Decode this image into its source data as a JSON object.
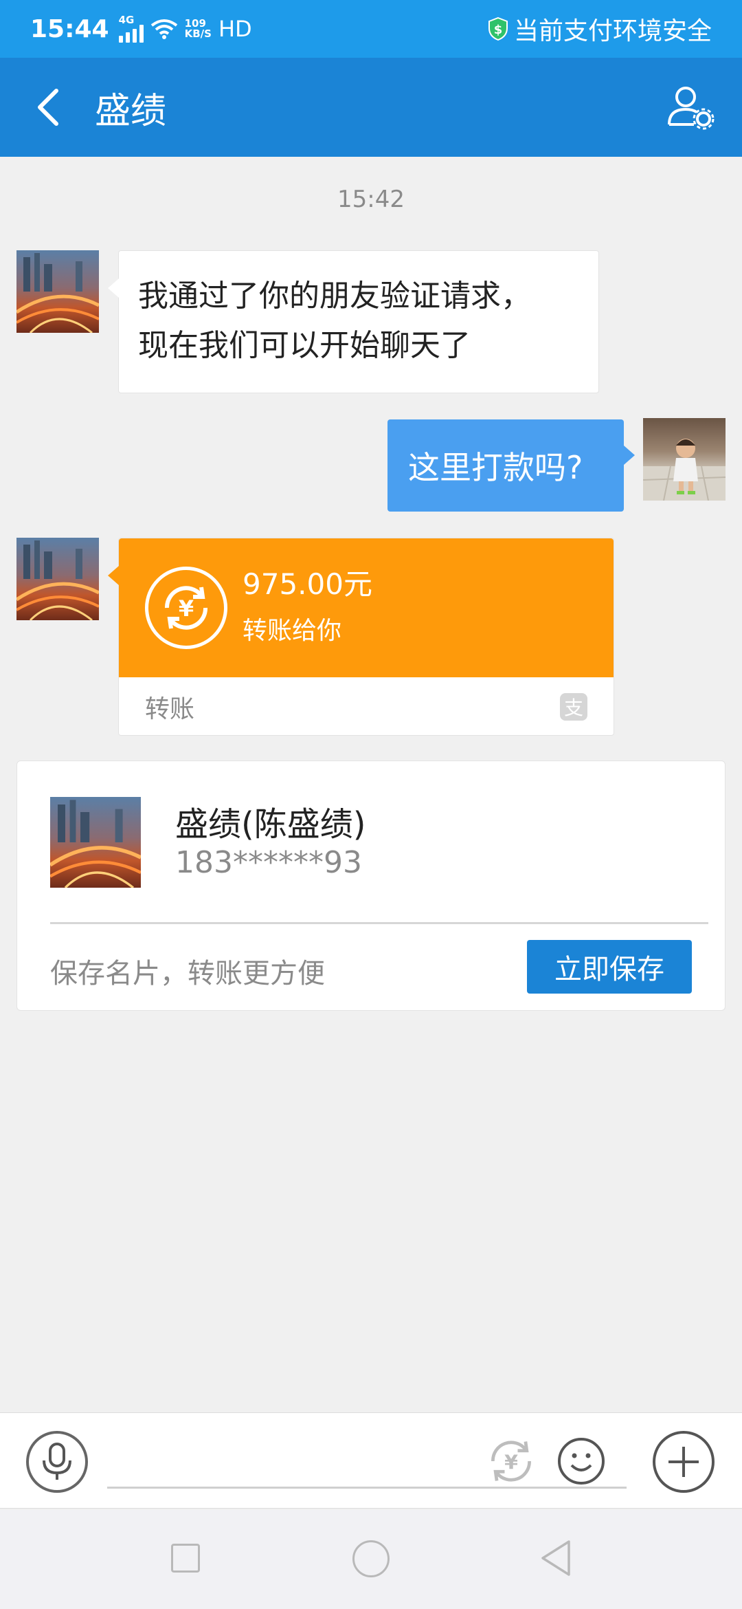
{
  "status_bar": {
    "time": "15:44",
    "network": "4G",
    "speed_value": "109",
    "speed_unit": "KB/S",
    "hd": "HD",
    "security_text": "当前支付环境安全",
    "icons": [
      "signal-icon",
      "wifi-icon",
      "shield-dollar-icon"
    ]
  },
  "header": {
    "title": "盛绩",
    "icons": [
      "back-arrow-icon",
      "user-settings-icon"
    ]
  },
  "chat": {
    "timestamp": "15:42",
    "messages": [
      {
        "side": "left",
        "line1": "我通过了你的朋友验证请求，",
        "line2": "现在我们可以开始聊天了"
      },
      {
        "side": "right",
        "text": "这里打款吗?"
      }
    ],
    "transfer": {
      "amount": "975.00元",
      "note": "转账给你",
      "label": "转账",
      "colors": {
        "accent": "#fe9a0b"
      },
      "icons": [
        "yuan-transfer-icon",
        "alipay-icon"
      ]
    }
  },
  "contact_card": {
    "name": "盛绩(陈盛绩)",
    "phone": "183******93",
    "hint": "保存名片，转账更方便",
    "save_label": "立即保存"
  },
  "input_bar": {
    "placeholder": "",
    "icons": [
      "microphone-icon",
      "yuan-icon",
      "emoji-icon",
      "plus-icon"
    ]
  },
  "nav_bar": {
    "icons": [
      "recent-apps-icon",
      "home-icon",
      "back-icon"
    ]
  },
  "colors": {
    "status_bar": "#1e9bea",
    "title_bar": "#1b84d6",
    "bubble_blue": "#4a9ff0",
    "background": "#f0f0f0"
  }
}
